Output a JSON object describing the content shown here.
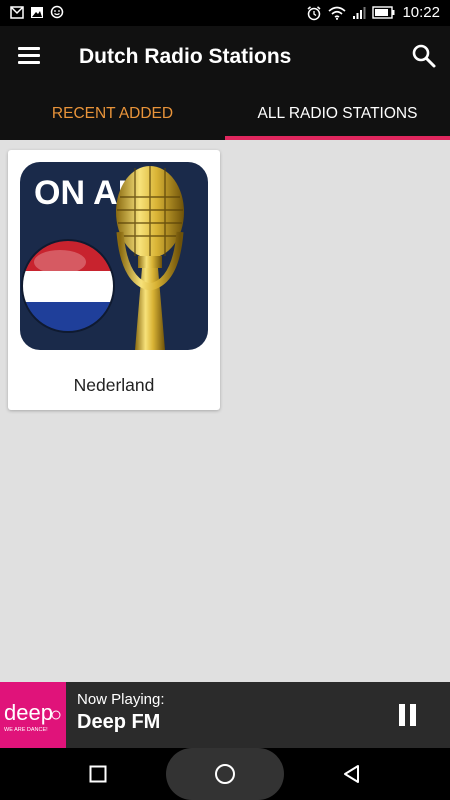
{
  "status_bar": {
    "time": "10:22",
    "left_icons": [
      "mail-icon",
      "image-icon",
      "smiley-icon"
    ],
    "right_icons": [
      "alarm-icon",
      "wifi-icon",
      "signal-icon",
      "battery-icon"
    ]
  },
  "app_bar": {
    "title": "Dutch Radio Stations",
    "menu_icon": "hamburger-menu-icon",
    "search_icon": "search-icon"
  },
  "tabs": [
    {
      "label": "RECENT ADDED",
      "selected": false
    },
    {
      "label": "ALL RADIO STATIONS",
      "selected": true
    }
  ],
  "colors": {
    "accent_orange": "#e9943a",
    "indicator_pink": "#e0275e",
    "deep_pink": "#e0137a"
  },
  "stations": [
    {
      "name": "Nederland",
      "art_icon": "on-air-microphone-netherlands-icon",
      "art_text": "ON AIR"
    }
  ],
  "player": {
    "label": "Now Playing:",
    "title": "Deep FM",
    "logo_icon": "deep-fm-logo",
    "logo_text": "deep",
    "logo_tagline": "WE ARE DANCE!",
    "control_icon": "pause-icon"
  },
  "nav_bar": {
    "buttons": [
      "recents-square-icon",
      "home-circle-icon",
      "back-triangle-icon"
    ]
  }
}
